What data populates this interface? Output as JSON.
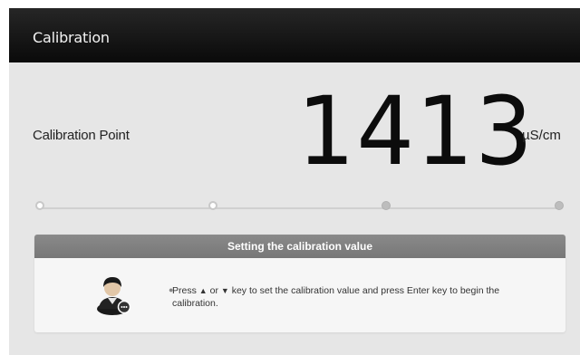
{
  "header": {
    "title": "Calibration"
  },
  "calibration": {
    "label": "Calibration Point",
    "value": "1413",
    "unit": "µS/cm"
  },
  "steps": {
    "total": 4,
    "active_through": 2
  },
  "panel": {
    "title": "Setting the calibration value",
    "instruction": {
      "part1": "Press ",
      "up_arrow": "▲",
      "or": " or ",
      "down_arrow": "▼",
      "part2": " key to set the calibration value and press Enter key to begin the calibration."
    },
    "icon": "user-avatar-icon"
  },
  "colors": {
    "titlebar": "#111111",
    "background": "#e6e6e6",
    "panel_header": "#808080"
  }
}
